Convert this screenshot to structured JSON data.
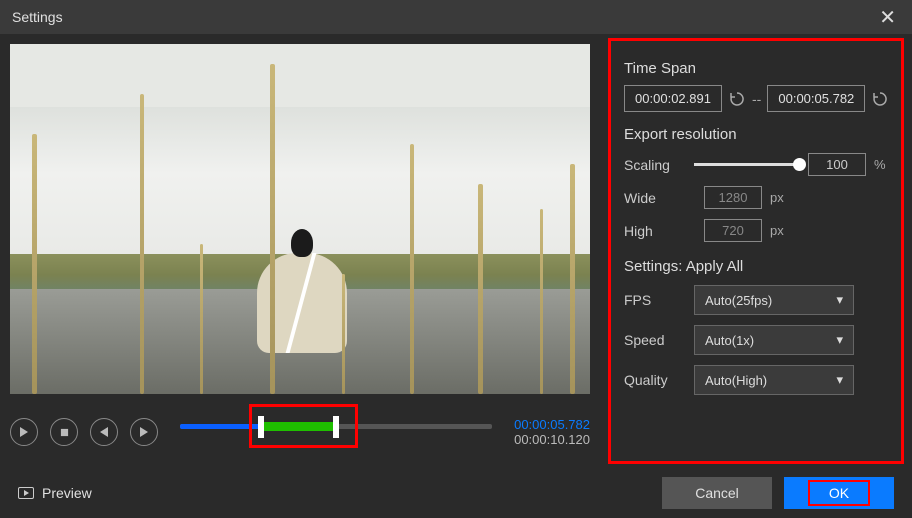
{
  "titlebar": {
    "title": "Settings"
  },
  "playback": {
    "current_time": "00:00:05.782",
    "total_time": "00:00:10.120"
  },
  "right": {
    "timespan": {
      "title": "Time Span",
      "start": "00:00:02.891",
      "end": "00:00:05.782",
      "separator": "--"
    },
    "resolution": {
      "title": "Export resolution",
      "scaling_label": "Scaling",
      "scaling_value": "100",
      "scaling_unit": "%",
      "wide_label": "Wide",
      "wide_value": "1280",
      "wide_unit": "px",
      "high_label": "High",
      "high_value": "720",
      "high_unit": "px"
    },
    "apply_all": {
      "title": "Settings: Apply All",
      "fps_label": "FPS",
      "fps_value": "Auto(25fps)",
      "speed_label": "Speed",
      "speed_value": "Auto(1x)",
      "quality_label": "Quality",
      "quality_value": "Auto(High)"
    }
  },
  "footer": {
    "preview_label": "Preview",
    "cancel_label": "Cancel",
    "ok_label": "OK"
  }
}
